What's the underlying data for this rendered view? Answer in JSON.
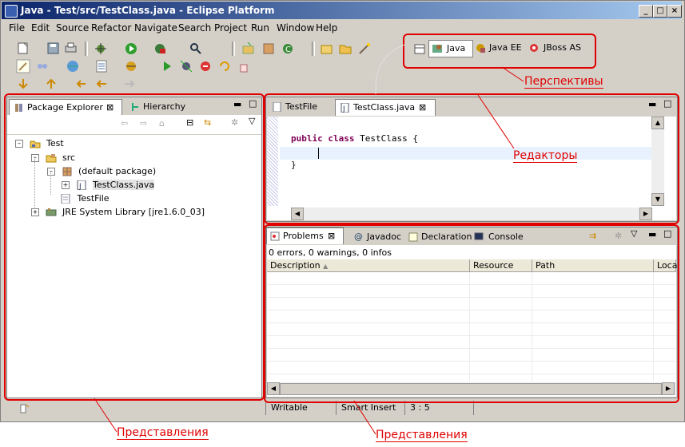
{
  "window": {
    "title": "Java - Test/src/TestClass.java - Eclipse Platform",
    "controls": {
      "minimize": "_",
      "maximize": "□",
      "close": "×"
    }
  },
  "menu": [
    "File",
    "Edit",
    "Source",
    "Refactor",
    "Navigate",
    "Search",
    "Project",
    "Run",
    "Window",
    "Help"
  ],
  "perspectives": {
    "java": "Java",
    "javaee": "Java EE",
    "jboss": "JBoss AS"
  },
  "explorer": {
    "tabs": {
      "package_explorer": "Package Explorer",
      "hierarchy": "Hierarchy"
    },
    "tree": {
      "project": "Test",
      "src": "src",
      "package": "(default package)",
      "class_file": "TestClass.java",
      "file": "TestFile",
      "library": "JRE System Library [jre1.6.0_03]"
    }
  },
  "editor": {
    "tabs": {
      "testfile": "TestFile",
      "testclass": "TestClass.java"
    },
    "code": {
      "kw1": "public",
      "kw2": "class",
      "name": "TestClass {",
      "close": "}"
    }
  },
  "bottom": {
    "tabs": {
      "problems": "Problems",
      "javadoc": "Javadoc",
      "declaration": "Declaration",
      "console": "Console"
    },
    "summary": "0 errors, 0 warnings, 0 infos",
    "columns": {
      "description": "Description",
      "resource": "Resource",
      "path": "Path",
      "location": "Loca"
    }
  },
  "status": {
    "writable": "Writable",
    "insert": "Smart Insert",
    "position": "3 : 5"
  },
  "annotations": {
    "perspectives": "Перспективы",
    "editors": "Редакторы",
    "views_left": "Представления",
    "views_bottom": "Представления"
  },
  "colors": {
    "annotation": "#e00000",
    "keyword": "#7f0055",
    "title_start": "#0a246a",
    "title_end": "#a6caf0"
  }
}
